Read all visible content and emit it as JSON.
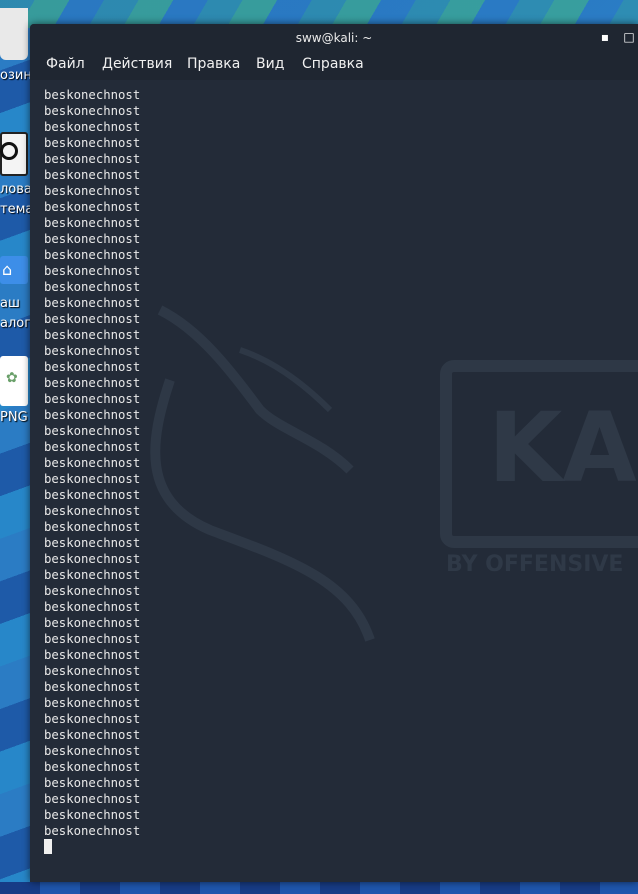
{
  "window": {
    "title": "sww@kali: ~",
    "minimize_glyph": "▪",
    "maximize_glyph": "□"
  },
  "menu": {
    "file": "Файл",
    "actions": "Действия",
    "edit": "Правка",
    "view": "Вид",
    "help": "Справка"
  },
  "desktop_icons": [
    {
      "name": "trash",
      "label": "озина"
    },
    {
      "name": "filesystem",
      "label": "лова",
      "label2": "тема"
    },
    {
      "name": "home",
      "label": "аш",
      "label2": "алог"
    },
    {
      "name": "png-file",
      "label": "PNG"
    }
  ],
  "watermark": {
    "logo_text": "KA",
    "tagline": "BY OFFENSIVE"
  },
  "terminal": {
    "output_lines": [
      "beskonechnost",
      "beskonechnost",
      "beskonechnost",
      "beskonechnost",
      "beskonechnost",
      "beskonechnost",
      "beskonechnost",
      "beskonechnost",
      "beskonechnost",
      "beskonechnost",
      "beskonechnost",
      "beskonechnost",
      "beskonechnost",
      "beskonechnost",
      "beskonechnost",
      "beskonechnost",
      "beskonechnost",
      "beskonechnost",
      "beskonechnost",
      "beskonechnost",
      "beskonechnost",
      "beskonechnost",
      "beskonechnost",
      "beskonechnost",
      "beskonechnost",
      "beskonechnost",
      "beskonechnost",
      "beskonechnost",
      "beskonechnost",
      "beskonechnost",
      "beskonechnost",
      "beskonechnost",
      "beskonechnost",
      "beskonechnost",
      "beskonechnost",
      "beskonechnost",
      "beskonechnost",
      "beskonechnost",
      "beskonechnost",
      "beskonechnost",
      "beskonechnost",
      "beskonechnost",
      "beskonechnost",
      "beskonechnost",
      "beskonechnost",
      "beskonechnost",
      "beskonechnost"
    ]
  },
  "colors": {
    "terminal_bg": "#232b38",
    "text": "#e8e8e8",
    "titlebar": "#1f2631"
  }
}
